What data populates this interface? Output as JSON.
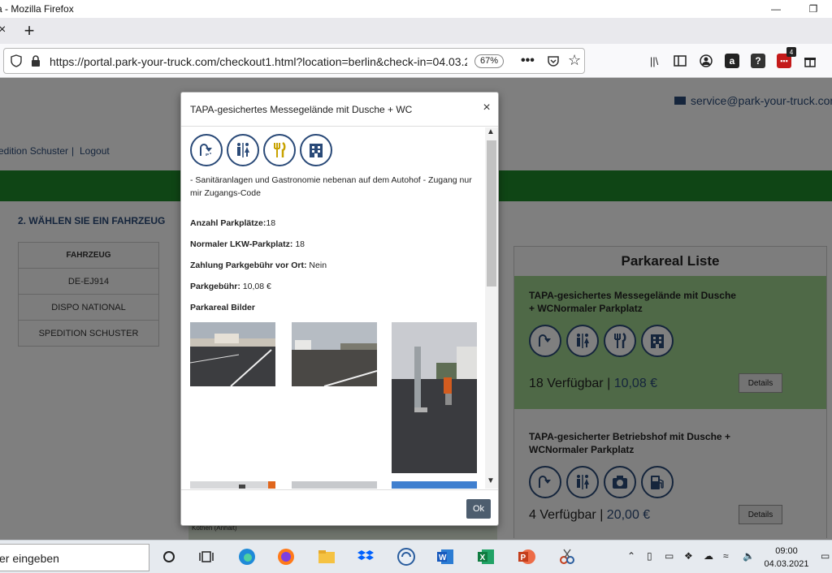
{
  "browser": {
    "window_title": "a - Mozilla Firefox",
    "url": "https://portal.park-your-truck.com/checkout1.html?location=berlin&check-in=04.03.2",
    "zoom": "67%",
    "tab_close_glyph": "×",
    "new_tab_glyph": "+",
    "menu_glyph": "•••",
    "star_glyph": "☆",
    "notification_badge": "4",
    "toolbar_icons": [
      "library-icon",
      "sidebar-icon",
      "account-icon",
      "amazon-icon",
      "help-icon",
      "extension-icon",
      "gift-icon"
    ]
  },
  "page": {
    "email": "service@park-your-truck.com",
    "user": "edition Schuster",
    "separator": "|",
    "logout": "Logout",
    "step_title": "2. WÄHLEN SIE EIN FAHRZEUG",
    "vehicle_table": {
      "header": "FAHRZEUG",
      "rows": [
        "DE-EJ914",
        "DISPO NATIONAL",
        "SPEDITION SCHUSTER"
      ]
    },
    "parkareal_list": {
      "title": "Parkareal Liste",
      "cards": [
        {
          "name": "TAPA-gesichertes Messegelände mit Dusche + WCNormaler Parkplatz",
          "available": "18 Verfügbar",
          "sep": "|",
          "price": "10,08 €",
          "details": "Details"
        },
        {
          "name": "TAPA-gesicherter Betriebshof mit Dusche + WCNormaler Parkplatz",
          "available": "4 Verfügbar",
          "sep": "|",
          "price": "20,00 €",
          "details": "Details"
        }
      ]
    },
    "map_label": "Köthen (Anhalt)"
  },
  "modal": {
    "title": "TAPA-gesichertes Messegelände mit Dusche + WC",
    "close": "×",
    "icons": [
      "shower-icon",
      "restroom-icon",
      "restaurant-icon",
      "hotel-icon"
    ],
    "description": "- Sanitäranlagen und Gastronomie nebenan auf dem Autohof - Zugang nur mir Zugangs-Code",
    "fields": [
      {
        "label": "Anzahl Parkplätze:",
        "value": "18"
      },
      {
        "label": "Normaler LKW-Parkplatz:",
        "value": " 18"
      },
      {
        "label": "Zahlung Parkgebühr vor Ort:",
        "value": " Nein"
      },
      {
        "label": "Parkgebühr:",
        "value": " 10,08 €"
      }
    ],
    "gallery_title": "Parkareal Bilder",
    "ok": "Ok"
  },
  "taskbar": {
    "search_text": "er eingeben",
    "time": "09:00",
    "date": "04.03.2021"
  }
}
